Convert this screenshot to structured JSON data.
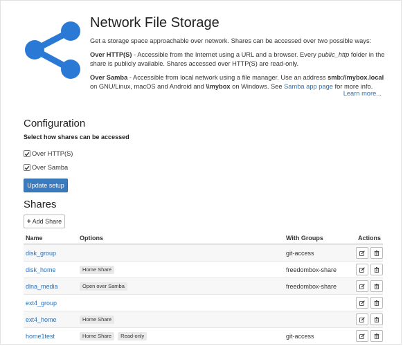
{
  "colors": {
    "accent": "#3a7bbf",
    "link": "#2a6fb5",
    "logo": "#2979d5"
  },
  "header": {
    "title": "Network File Storage",
    "logo_icon": "share-icon",
    "intro": {
      "p1": "Get a storage space approachable over network. Shares can be accessed over two possible ways:",
      "http_label": "Over HTTP(S)",
      "http_text_1": " - Accessible from the Internet using a URL and a browser. Every ",
      "http_folder": "public_http",
      "http_text_2": " folder in the share is publicly available. Shares accessed over HTTP(S) are read-only.",
      "samba_label": "Over Samba",
      "samba_text_1": " - Accessible from local network using a file manager. Use an address ",
      "samba_address": "smb://mybox.local",
      "samba_text_2": " on GNU/Linux, macOS and Android and ",
      "samba_windows": "\\\\mybox",
      "samba_text_3": " on Windows. See ",
      "samba_link": "Samba app page",
      "samba_text_4": " for more info."
    },
    "learn_more": "Learn more..."
  },
  "configuration": {
    "title": "Configuration",
    "subtitle": "Select how shares can be accessed",
    "options": [
      {
        "label": "Over HTTP(S)",
        "checked": true
      },
      {
        "label": "Over Samba",
        "checked": true
      }
    ],
    "update_button": "Update setup"
  },
  "shares": {
    "title": "Shares",
    "add_button": "Add Share",
    "columns": {
      "name": "Name",
      "options": "Options",
      "groups": "With Groups",
      "actions": "Actions"
    },
    "rows": [
      {
        "name": "disk_group",
        "options": [],
        "groups": "git-access"
      },
      {
        "name": "disk_home",
        "options": [
          "Home Share"
        ],
        "groups": "freedombox-share"
      },
      {
        "name": "dlna_media",
        "options": [
          "Open over Samba"
        ],
        "groups": "freedombox-share"
      },
      {
        "name": "ext4_group",
        "options": [],
        "groups": ""
      },
      {
        "name": "ext4_home",
        "options": [
          "Home Share"
        ],
        "groups": ""
      },
      {
        "name": "home1test",
        "options": [
          "Home Share",
          "Read-only"
        ],
        "groups": "git-access"
      }
    ]
  }
}
